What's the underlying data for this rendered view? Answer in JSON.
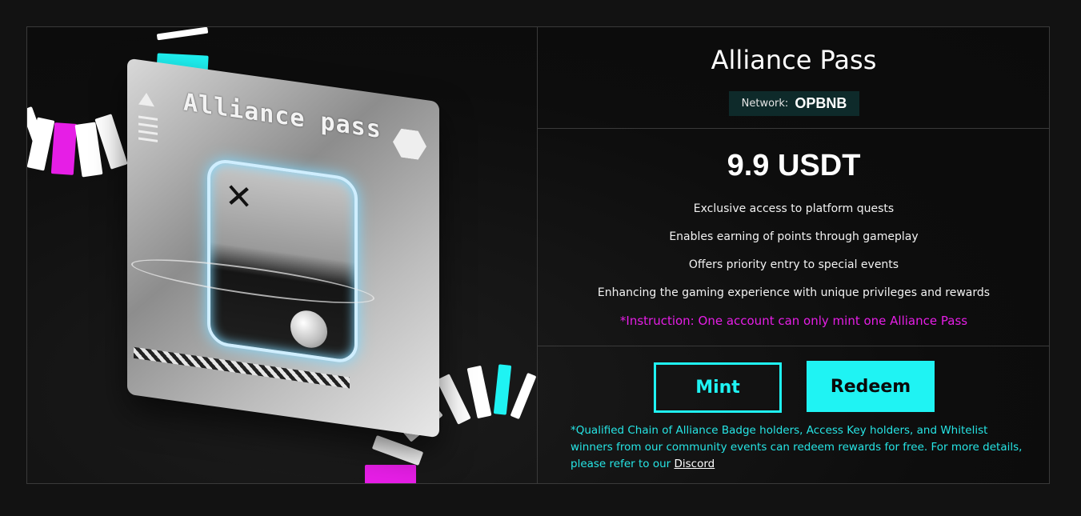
{
  "card": {
    "art_title": "Alliance pass"
  },
  "pass": {
    "title": "Alliance Pass",
    "network_label": "Network:",
    "network_value": "OPBNB",
    "price": "9.9 USDT",
    "features": [
      "Exclusive access to platform quests",
      "Enables earning of points through gameplay",
      "Offers priority entry to special events",
      "Enhancing the gaming experience with unique privileges and rewards"
    ],
    "instruction": "*Instruction: One account can only mint one Alliance Pass"
  },
  "actions": {
    "mint_label": "Mint",
    "redeem_label": "Redeem"
  },
  "note": {
    "text": "*Qualified Chain of Alliance Badge holders, Access Key holders, and Whitelist winners from our community events can redeem rewards for free. For more details, please refer to our ",
    "link_label": "Discord"
  },
  "colors": {
    "accent_cyan": "#1ff3f3",
    "accent_magenta": "#e61ee6",
    "network_bg": "#0e2a2a"
  }
}
